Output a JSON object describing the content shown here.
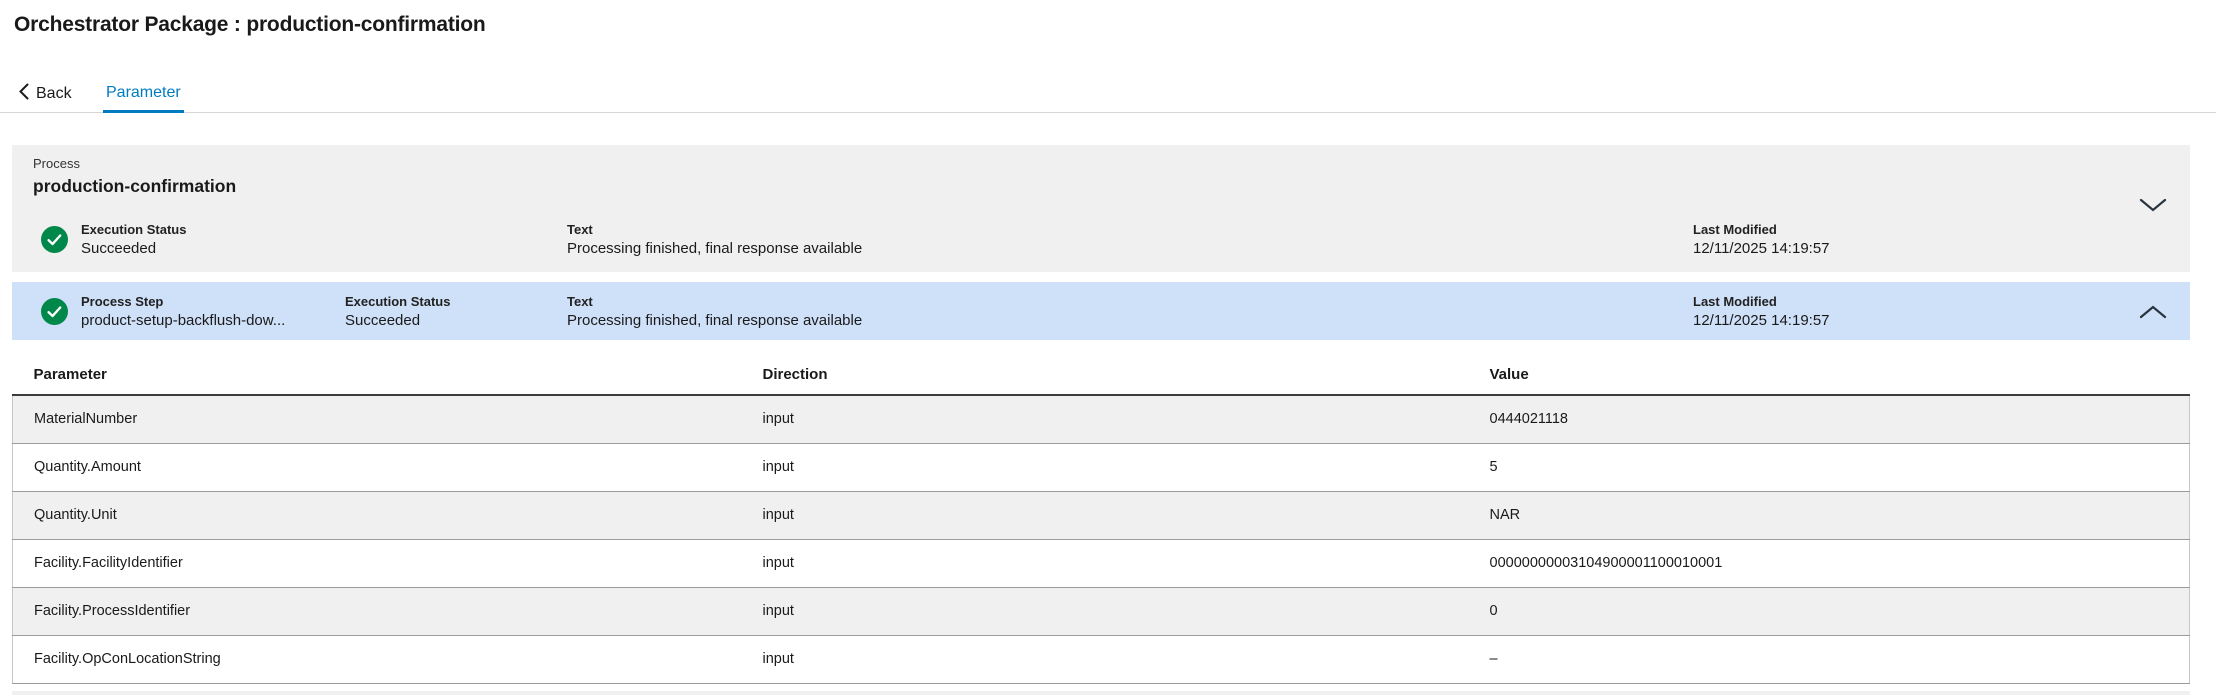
{
  "header": {
    "title": "Orchestrator Package : production-confirmation",
    "back_label": "Back"
  },
  "tabs": [
    {
      "label": "Parameter",
      "active": true
    }
  ],
  "process": {
    "group_label": "Process",
    "name": "production-confirmation",
    "status": "success",
    "fields": [
      {
        "label": "Execution Status",
        "value": "Succeeded"
      },
      {
        "label": "Text",
        "value": "Processing finished, final response available"
      },
      {
        "label": "Last Modified",
        "value": "12/11/2025 14:19:57"
      }
    ]
  },
  "process_step": {
    "status": "success",
    "selected": true,
    "fields": [
      {
        "label": "Process Step",
        "value": "product-setup-backflush-dow..."
      },
      {
        "label": "Execution Status",
        "value": "Succeeded"
      },
      {
        "label": "Text",
        "value": "Processing finished, final response available"
      },
      {
        "label": "Last Modified",
        "value": "12/11/2025 14:19:57"
      }
    ]
  },
  "parameter_table": {
    "columns": [
      "Parameter",
      "Direction",
      "Value"
    ],
    "rows": [
      {
        "parameter": "MaterialNumber",
        "direction": "input",
        "value": "0444021118"
      },
      {
        "parameter": "Quantity.Amount",
        "direction": "input",
        "value": "5"
      },
      {
        "parameter": "Quantity.Unit",
        "direction": "input",
        "value": "NAR"
      },
      {
        "parameter": "Facility.FacilityIdentifier",
        "direction": "input",
        "value": "00000000003104900001100010001"
      },
      {
        "parameter": "Facility.ProcessIdentifier",
        "direction": "input",
        "value": "0"
      },
      {
        "parameter": "Facility.OpConLocationString",
        "direction": "input",
        "value": "–"
      }
    ]
  },
  "icons": {
    "back": "chevron-left-icon",
    "status": "check-circle-icon",
    "process_toggle": "chevron-down-icon",
    "step_toggle": "chevron-up-icon"
  },
  "colors": {
    "accent_blue": "#007BC0",
    "success_green": "#00884A",
    "selected_row_blue": "#CFE0F9",
    "panel_gray": "#F0F0F1"
  }
}
